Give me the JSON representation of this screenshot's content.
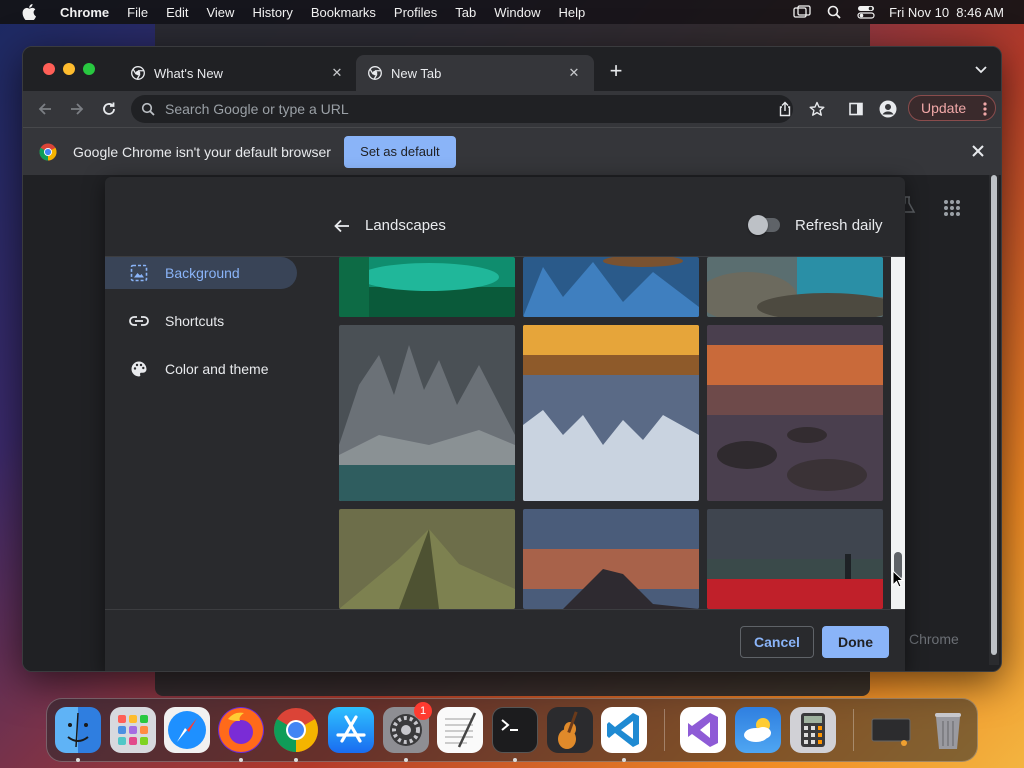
{
  "menubar": {
    "app_name": "Chrome",
    "items": [
      "File",
      "Edit",
      "View",
      "History",
      "Bookmarks",
      "Profiles",
      "Tab",
      "Window",
      "Help"
    ],
    "clock": "Fri Nov 10  8:46 AM"
  },
  "browser": {
    "tabs": [
      {
        "title": "What's New",
        "active": false
      },
      {
        "title": "New Tab",
        "active": true
      }
    ],
    "omnibox_placeholder": "Search Google or type a URL",
    "update_label": "Update",
    "infobar": {
      "message": "Google Chrome isn't your default browser",
      "button": "Set as default"
    },
    "background_text": "Chrome"
  },
  "dialog": {
    "title": "Landscapes",
    "refresh_label": "Refresh daily",
    "refresh_on": false,
    "sidebar": [
      {
        "label": "Background",
        "icon": "image-icon",
        "active": true
      },
      {
        "label": "Shortcuts",
        "icon": "link-icon",
        "active": false
      },
      {
        "label": "Color and theme",
        "icon": "palette-icon",
        "active": false
      }
    ],
    "cancel_label": "Cancel",
    "done_label": "Done"
  },
  "dock": {
    "apps": [
      "Finder",
      "Launchpad",
      "Safari",
      "Firefox",
      "Chrome",
      "App Store",
      "System Settings",
      "TextEdit",
      "Terminal",
      "GarageBand",
      "Visual Studio Code",
      "Visual Studio",
      "Weather",
      "Calculator",
      "Screenshot",
      "Trash"
    ],
    "settings_badge": "1"
  },
  "colors": {
    "accent": "#8ab4f8",
    "dialog_bg": "#292a2d",
    "toolbar_bg": "#35363a"
  }
}
